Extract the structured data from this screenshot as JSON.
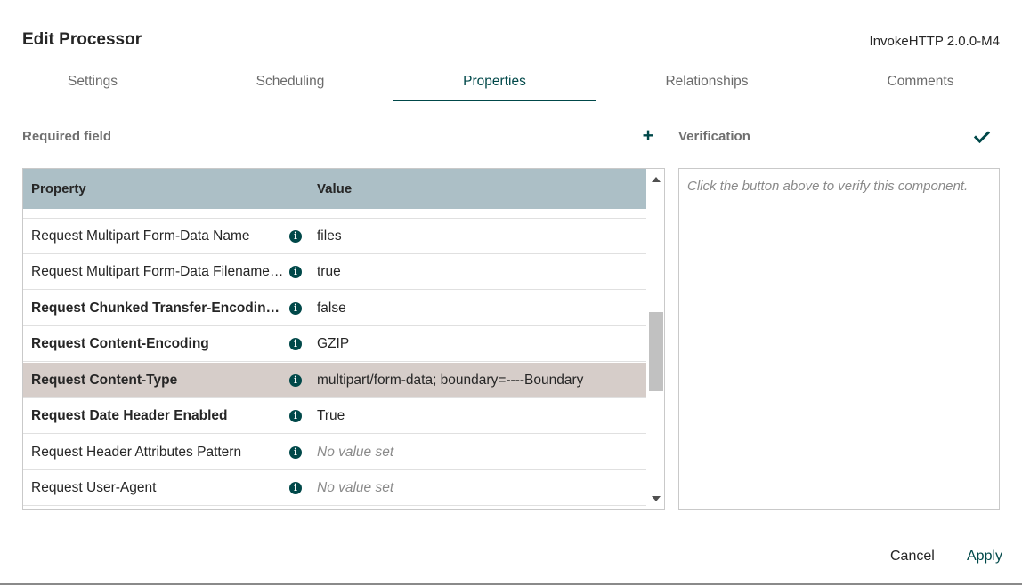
{
  "dialog": {
    "title": "Edit Processor",
    "processor_type": "InvokeHTTP 2.0.0-M4"
  },
  "tabs": [
    {
      "label": "Settings"
    },
    {
      "label": "Scheduling"
    },
    {
      "label": "Properties",
      "active": true
    },
    {
      "label": "Relationships"
    },
    {
      "label": "Comments"
    }
  ],
  "properties": {
    "required_label": "Required field",
    "add_icon": "plus-icon",
    "columns": {
      "property": "Property",
      "value": "Value"
    },
    "rows": [
      {
        "name": "Request Multipart Form-Data Name",
        "value": "files",
        "required": false
      },
      {
        "name": "Request Multipart Form-Data Filename Enabled",
        "value": "true",
        "required": false
      },
      {
        "name": "Request Chunked Transfer-Encoding Enabled",
        "value": "false",
        "required": true
      },
      {
        "name": "Request Content-Encoding",
        "value": "GZIP",
        "required": true
      },
      {
        "name": "Request Content-Type",
        "value": "multipart/form-data; boundary=----Boundary",
        "required": true,
        "selected": true
      },
      {
        "name": "Request Date Header Enabled",
        "value": "True",
        "required": true
      },
      {
        "name": "Request Header Attributes Pattern",
        "value": "No value set",
        "required": false,
        "empty": true
      },
      {
        "name": "Request User-Agent",
        "value": "No value set",
        "required": false,
        "empty": true
      }
    ],
    "info_icon": "info-icon"
  },
  "verification": {
    "label": "Verification",
    "icon": "checkmark-icon",
    "placeholder": "Click the button above to verify this component."
  },
  "footer": {
    "cancel_label": "Cancel",
    "apply_label": "Apply"
  },
  "colors": {
    "accent": "#004849",
    "header": "#acbfc6",
    "selected_row": "#d6cdc9"
  }
}
